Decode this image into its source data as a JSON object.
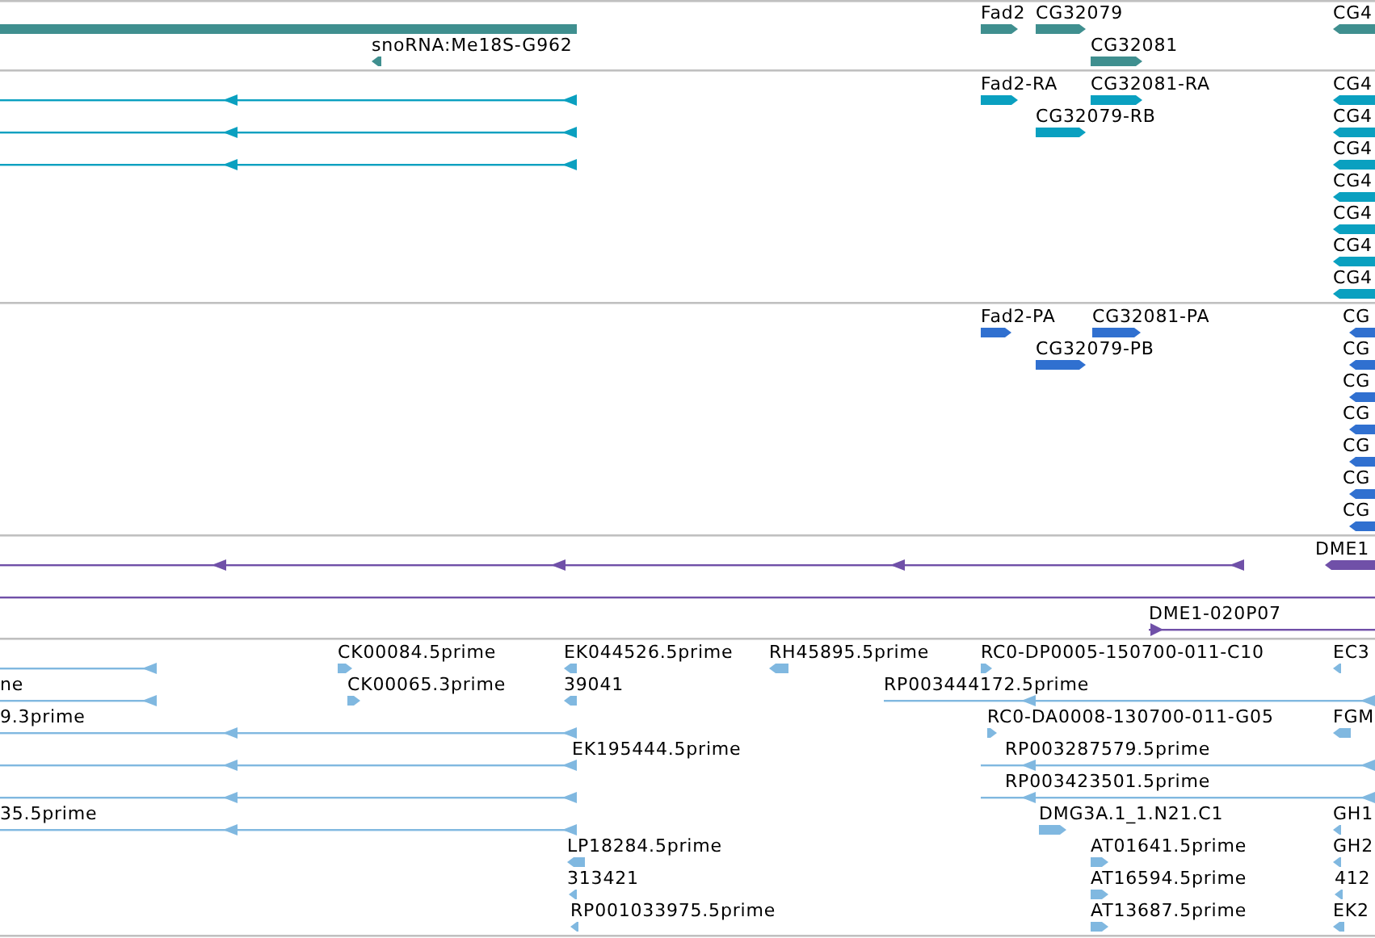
{
  "tracks": [
    {
      "color": "#3f8f8f",
      "rows": [
        {
          "items": [
            {
              "kind": "block"
            },
            {
              "label": "Fad2",
              "kind": "block",
              "reverse": false
            },
            {
              "label": "CG32079",
              "kind": "block",
              "reverse": false
            },
            {
              "label": "CG4",
              "kind": "block",
              "reverse": true
            }
          ]
        },
        {
          "items": [
            {
              "label": "snoRNA:Me18S-G962",
              "kind": "block",
              "reverse": true
            },
            {
              "label": "CG32081",
              "kind": "block",
              "reverse": false
            }
          ]
        }
      ]
    },
    {
      "color": "#0aa0c0",
      "rows": [
        {
          "items": [
            {
              "kind": "line",
              "reverse": true
            },
            {
              "label": "Fad2-RA",
              "kind": "block",
              "reverse": false
            },
            {
              "label": "CG32081-RA",
              "kind": "block",
              "reverse": false
            },
            {
              "label": "CG4",
              "kind": "block",
              "reverse": true
            }
          ]
        },
        {
          "items": [
            {
              "kind": "line",
              "reverse": true
            },
            {
              "label": "CG32079-RB",
              "kind": "block",
              "reverse": false
            },
            {
              "label": "CG4",
              "kind": "block",
              "reverse": true
            }
          ]
        },
        {
          "items": [
            {
              "kind": "line",
              "reverse": true
            },
            {
              "label": "CG4",
              "kind": "block",
              "reverse": true
            }
          ]
        },
        {
          "items": [
            {
              "label": "CG4",
              "kind": "block",
              "reverse": true
            }
          ]
        },
        {
          "items": [
            {
              "label": "CG4",
              "kind": "block",
              "reverse": true
            }
          ]
        },
        {
          "items": [
            {
              "label": "CG4",
              "kind": "block",
              "reverse": true
            }
          ]
        },
        {
          "items": [
            {
              "label": "CG4",
              "kind": "block",
              "reverse": true
            }
          ]
        }
      ]
    },
    {
      "color": "#3070d0",
      "rows": [
        {
          "items": [
            {
              "label": "Fad2-PA",
              "kind": "block",
              "reverse": false
            },
            {
              "label": "CG32081-PA",
              "kind": "block",
              "reverse": false
            },
            {
              "label": "CG",
              "kind": "block",
              "reverse": true
            }
          ]
        },
        {
          "items": [
            {
              "label": "CG32079-PB",
              "kind": "block",
              "reverse": false
            },
            {
              "label": "CG",
              "kind": "block",
              "reverse": true
            }
          ]
        },
        {
          "items": [
            {
              "label": "CG",
              "kind": "block",
              "reverse": true
            }
          ]
        },
        {
          "items": [
            {
              "label": "CG",
              "kind": "block",
              "reverse": true
            }
          ]
        },
        {
          "items": [
            {
              "label": "CG",
              "kind": "block",
              "reverse": true
            }
          ]
        },
        {
          "items": [
            {
              "label": "CG",
              "kind": "block",
              "reverse": true
            }
          ]
        },
        {
          "items": [
            {
              "label": "CG",
              "kind": "block",
              "reverse": true
            }
          ]
        }
      ]
    },
    {
      "color": "#7050a8",
      "rows": [
        {
          "items": [
            {
              "kind": "line",
              "reverse": true
            },
            {
              "label": "DME1",
              "kind": "block",
              "reverse": true
            }
          ]
        },
        {
          "items": [
            {
              "kind": "line"
            }
          ]
        },
        {
          "items": [
            {
              "label": "DME1-020P07",
              "kind": "line",
              "reverse": false
            }
          ]
        }
      ]
    },
    {
      "color": "#80b8e0",
      "rows": [
        {
          "items": [
            {
              "kind": "line",
              "reverse": true
            },
            {
              "label": "CK00084.5prime",
              "kind": "block",
              "reverse": false
            },
            {
              "label": "EK044526.5prime",
              "kind": "block",
              "reverse": true
            },
            {
              "label": "RH45895.5prime",
              "kind": "block",
              "reverse": true
            },
            {
              "label": "RC0-DP0005-150700-011-C10",
              "kind": "block",
              "reverse": false
            },
            {
              "label": "EC3",
              "kind": "block",
              "reverse": true
            }
          ]
        },
        {
          "items": [
            {
              "label": "ne",
              "kind": "line",
              "reverse": true
            },
            {
              "label": "CK00065.3prime",
              "kind": "block",
              "reverse": false
            },
            {
              "label": "39041",
              "kind": "block",
              "reverse": true
            },
            {
              "label": "RP003444172.5prime",
              "kind": "line",
              "reverse": true
            }
          ]
        },
        {
          "items": [
            {
              "label": "9.3prime",
              "kind": "line",
              "reverse": true
            },
            {
              "label": "RC0-DA0008-130700-011-G05",
              "kind": "block",
              "reverse": false
            },
            {
              "label": "FGM",
              "kind": "block",
              "reverse": true
            }
          ]
        },
        {
          "items": [
            {
              "label": "EK195444.5prime",
              "kind": "line",
              "reverse": true
            },
            {
              "label": "RP003287579.5prime",
              "kind": "line",
              "reverse": true
            }
          ]
        },
        {
          "items": [
            {
              "kind": "line",
              "reverse": true
            },
            {
              "label": "RP003423501.5prime",
              "kind": "line",
              "reverse": true
            }
          ]
        },
        {
          "items": [
            {
              "label": "35.5prime",
              "kind": "line",
              "reverse": true
            },
            {
              "label": "DMG3A.1_1.N21.C1",
              "kind": "block",
              "reverse": false
            },
            {
              "label": "GH1",
              "kind": "block",
              "reverse": true
            }
          ]
        },
        {
          "items": [
            {
              "label": "LP18284.5prime",
              "kind": "block",
              "reverse": true
            },
            {
              "label": "AT01641.5prime",
              "kind": "block",
              "reverse": false
            },
            {
              "label": "GH2",
              "kind": "block",
              "reverse": true
            }
          ]
        },
        {
          "items": [
            {
              "label": "313421",
              "kind": "block",
              "reverse": true
            },
            {
              "label": "AT16594.5prime",
              "kind": "block",
              "reverse": false
            },
            {
              "label": "412",
              "kind": "block",
              "reverse": true
            }
          ]
        },
        {
          "items": [
            {
              "label": "RP001033975.5prime",
              "kind": "block",
              "reverse": true
            },
            {
              "label": "AT13687.5prime",
              "kind": "block",
              "reverse": false
            },
            {
              "label": "EK2",
              "kind": "block",
              "reverse": true
            }
          ]
        }
      ]
    }
  ]
}
